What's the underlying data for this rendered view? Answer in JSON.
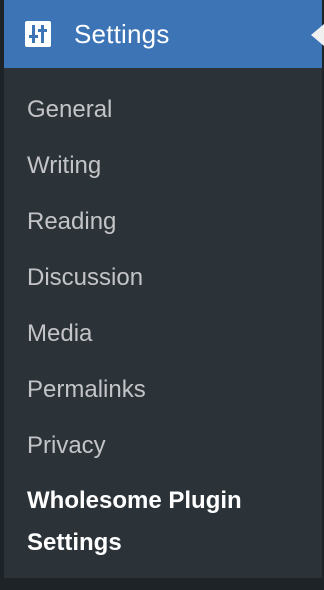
{
  "menu": {
    "header": {
      "label": "Settings",
      "icon": "settings-sliders-icon",
      "background": "#3c74b6"
    },
    "items": [
      {
        "label": "General"
      },
      {
        "label": "Writing"
      },
      {
        "label": "Reading"
      },
      {
        "label": "Discussion"
      },
      {
        "label": "Media"
      },
      {
        "label": "Permalinks"
      },
      {
        "label": "Privacy"
      },
      {
        "label": "Wholesome Plugin Settings",
        "active": true
      }
    ],
    "colors": {
      "menu_background": "#2c3338",
      "item_text": "#c3c4c7",
      "active_text": "#ffffff"
    }
  }
}
